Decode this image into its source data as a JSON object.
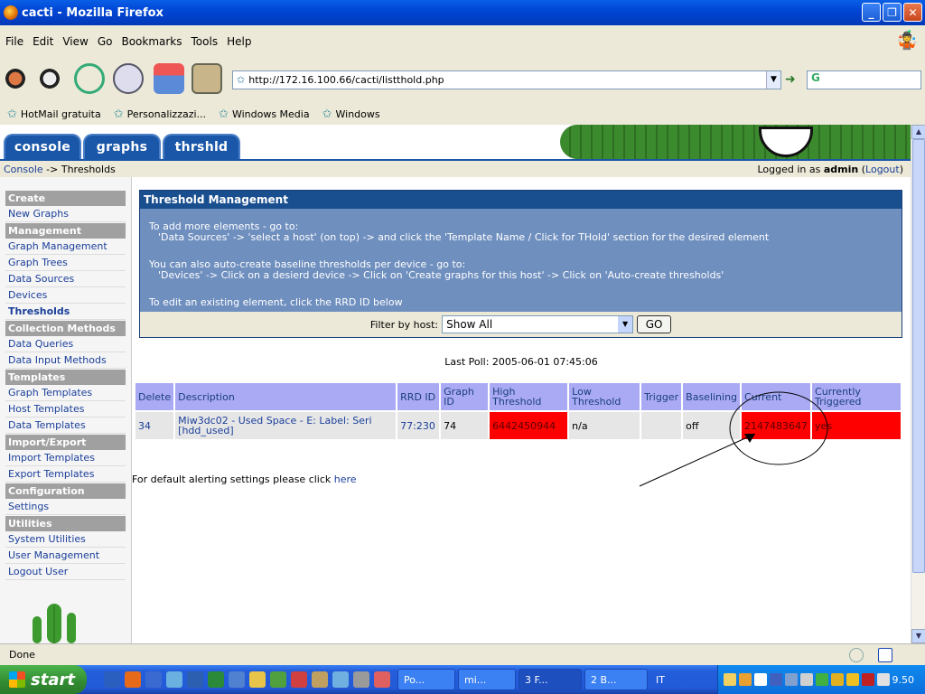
{
  "window": {
    "title": "cacti - Mozilla Firefox"
  },
  "menu": [
    "File",
    "Edit",
    "View",
    "Go",
    "Bookmarks",
    "Tools",
    "Help"
  ],
  "url": "http://172.16.100.66/cacti/listthold.php",
  "bookmarks": [
    "HotMail gratuita",
    "Personalizzazi...",
    "Windows Media",
    "Windows"
  ],
  "tabs": [
    "console",
    "graphs",
    "thrshld"
  ],
  "breadcrumb": {
    "home": "Console",
    "sep": " -> ",
    "current": "Thresholds"
  },
  "login": {
    "prefix": "Logged in as ",
    "user": "admin",
    "open": " (",
    "logout": "Logout",
    "close": ")"
  },
  "sidebar": [
    {
      "type": "head",
      "label": "Create"
    },
    {
      "type": "item",
      "label": "New Graphs"
    },
    {
      "type": "head",
      "label": "Management"
    },
    {
      "type": "item",
      "label": "Graph Management"
    },
    {
      "type": "item",
      "label": "Graph Trees"
    },
    {
      "type": "item",
      "label": "Data Sources"
    },
    {
      "type": "item",
      "label": "Devices"
    },
    {
      "type": "item",
      "label": "Thresholds",
      "active": true
    },
    {
      "type": "head",
      "label": "Collection Methods"
    },
    {
      "type": "item",
      "label": "Data Queries"
    },
    {
      "type": "item",
      "label": "Data Input Methods"
    },
    {
      "type": "head",
      "label": "Templates"
    },
    {
      "type": "item",
      "label": "Graph Templates"
    },
    {
      "type": "item",
      "label": "Host Templates"
    },
    {
      "type": "item",
      "label": "Data Templates"
    },
    {
      "type": "head",
      "label": "Import/Export"
    },
    {
      "type": "item",
      "label": "Import Templates"
    },
    {
      "type": "item",
      "label": "Export Templates"
    },
    {
      "type": "head",
      "label": "Configuration"
    },
    {
      "type": "item",
      "label": "Settings"
    },
    {
      "type": "head",
      "label": "Utilities"
    },
    {
      "type": "item",
      "label": "System Utilities"
    },
    {
      "type": "item",
      "label": "User Management"
    },
    {
      "type": "item",
      "label": "Logout User"
    }
  ],
  "panel": {
    "title": "Threshold Management",
    "line1": "To add more elements - go to:",
    "line2": "'Data Sources' -> 'select a host' (on top) -> and click the 'Template Name / Click for THold' section for the desired element",
    "line3": "You can also auto-create baseline thresholds per device - go to:",
    "line4": "'Devices' -> Click on a desierd device -> Click on 'Create graphs for this host' -> Click on 'Auto-create thresholds'",
    "line5": "To edit an existing element, click the RRD ID below"
  },
  "filter": {
    "label": "Filter by host:",
    "value": "Show All",
    "go": "GO"
  },
  "last_poll": "Last Poll: 2005-06-01 07:45:06",
  "table": {
    "headers": [
      "Delete",
      "Description",
      "RRD ID",
      "Graph ID",
      "High Threshold",
      "Low Threshold",
      "Trigger",
      "Baselining",
      "Current",
      "Currently Triggered"
    ],
    "row": {
      "delete": "34",
      "desc1": "Miw3dc02 - Used Space - E: Label: Seri",
      "desc2": "[hdd_used]",
      "rrd": "77:230",
      "graph": "74",
      "high": "6442450944",
      "low": "n/a",
      "trigger": "",
      "baselining": "off",
      "current": "2147483647",
      "triggered": "yes"
    }
  },
  "default_alert": {
    "text": "For default alerting settings please click ",
    "link": "here"
  },
  "status": "Done",
  "taskbar": {
    "start": "start",
    "buttons": [
      "Po...",
      "mi...",
      "3 F...",
      "2 B...",
      "IT"
    ],
    "clock": "9.50"
  }
}
